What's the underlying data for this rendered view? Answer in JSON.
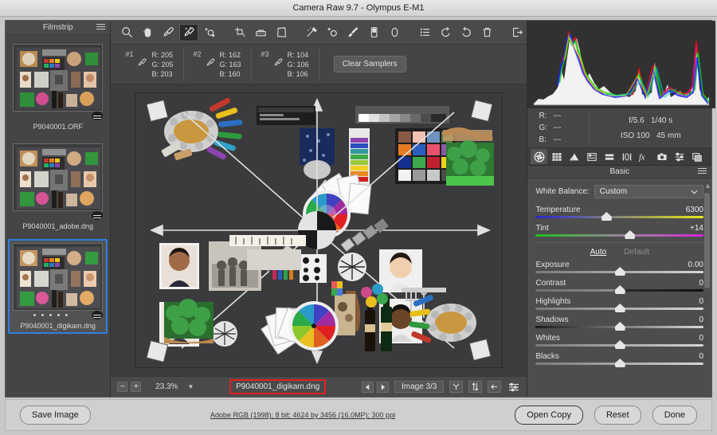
{
  "window": {
    "title": "Camera Raw 9.7  -  Olympus E-M1"
  },
  "filmstrip": {
    "header": "Filmstrip",
    "menu_icon": "hamburger-icon",
    "items": [
      {
        "label": "P9040001.ORF",
        "selected": false,
        "has_dots": false
      },
      {
        "label": "P9040001_adobe.dng",
        "selected": false,
        "has_dots": false
      },
      {
        "label": "P9040001_digikam.dng",
        "selected": true,
        "has_dots": true
      }
    ]
  },
  "toolbar": {
    "tools": [
      {
        "name": "zoom-tool",
        "icon": "magnifier-icon",
        "active": false
      },
      {
        "name": "hand-tool",
        "icon": "hand-icon",
        "active": false
      },
      {
        "name": "white-balance-tool",
        "icon": "eyedropper-icon",
        "active": false
      },
      {
        "name": "color-sampler-tool",
        "icon": "color-sampler-icon",
        "active": true
      },
      {
        "name": "targeted-adjustment-tool",
        "icon": "target-adjust-icon",
        "active": false
      },
      {
        "name": "crop-tool",
        "icon": "crop-icon",
        "active": false
      },
      {
        "name": "straighten-tool",
        "icon": "straighten-icon",
        "active": false
      },
      {
        "name": "transform-tool",
        "icon": "transform-icon",
        "active": false
      },
      {
        "name": "spot-removal-tool",
        "icon": "spot-removal-icon",
        "active": false
      },
      {
        "name": "red-eye-tool",
        "icon": "red-eye-icon",
        "active": false
      },
      {
        "name": "adjustment-brush-tool",
        "icon": "brush-icon",
        "active": false
      },
      {
        "name": "graduated-filter-tool",
        "icon": "graduated-filter-icon",
        "active": false
      },
      {
        "name": "radial-filter-tool",
        "icon": "radial-filter-icon",
        "active": false
      },
      {
        "name": "preferences-tool",
        "icon": "preferences-icon",
        "active": false
      },
      {
        "name": "rotate-left-tool",
        "icon": "rotate-ccw-icon",
        "active": false
      },
      {
        "name": "rotate-right-tool",
        "icon": "rotate-cw-icon",
        "active": false
      },
      {
        "name": "delete-tool",
        "icon": "trash-icon",
        "active": false
      },
      {
        "name": "open-preferences-tool",
        "icon": "export-icon",
        "active": false
      }
    ]
  },
  "samplers": {
    "clear_label": "Clear Samplers",
    "items": [
      {
        "id": "#1",
        "r": "R: 205",
        "g": "G: 205",
        "b": "B: 203"
      },
      {
        "id": "#2",
        "r": "R: 162",
        "g": "G: 163",
        "b": "B: 160"
      },
      {
        "id": "#3",
        "r": "R: 104",
        "g": "G: 106",
        "b": "B: 106"
      }
    ]
  },
  "bottombar": {
    "zoom_out": "−",
    "zoom_in": "+",
    "zoom_level": "23.3%",
    "zoom_dropdown_icon": "chevron-down-icon",
    "filename": "P9040001_digikam.dng",
    "filename_highlight_color": "#e02020",
    "prev_icon": "arrow-left-icon",
    "next_icon": "arrow-right-icon",
    "image_count": "Image 3/3",
    "minitools": [
      {
        "name": "synchronize-button",
        "icon": "Y-icon"
      },
      {
        "name": "swap-button",
        "icon": "two-arrows-icon"
      },
      {
        "name": "back-button",
        "icon": "arrow-left-box-icon"
      },
      {
        "name": "settings-button",
        "icon": "sliders-icon"
      }
    ]
  },
  "histogram": {
    "shadow_clip_icon": "triangle-shadow-clip-icon",
    "shadow_clip_color": "#2222dd",
    "highlight_clip_icon": "triangle-highlight-clip-icon",
    "highlight_clip_color": "#dd1111"
  },
  "info": {
    "r_label": "R:",
    "r_value": "---",
    "g_label": "G:",
    "g_value": "---",
    "b_label": "B:",
    "b_value": "---",
    "aperture": "f/5.6",
    "shutter": "1/40 s",
    "iso": "ISO 100",
    "focal": "45 mm"
  },
  "panel_tabs": [
    {
      "name": "tab-basic",
      "icon": "aperture-icon",
      "active": true
    },
    {
      "name": "tab-tone-curve",
      "icon": "tone-curve-icon",
      "active": false
    },
    {
      "name": "tab-detail",
      "icon": "detail-triangle-icon",
      "active": false
    },
    {
      "name": "tab-hsl-grayscale",
      "icon": "hsl-icon",
      "active": false
    },
    {
      "name": "tab-split-toning",
      "icon": "split-toning-icon",
      "active": false
    },
    {
      "name": "tab-lens-corrections",
      "icon": "lens-correction-icon",
      "active": false
    },
    {
      "name": "tab-effects",
      "icon": "fx-icon",
      "active": false
    },
    {
      "name": "tab-camera-calibration",
      "icon": "camera-icon",
      "active": false
    },
    {
      "name": "tab-presets",
      "icon": "presets-sliders-icon",
      "active": false
    },
    {
      "name": "tab-snapshots",
      "icon": "snapshots-icon",
      "active": false
    }
  ],
  "basic_panel": {
    "title": "Basic",
    "menu_icon": "hamburger-icon",
    "white_balance_label": "White Balance:",
    "white_balance_value": "Custom",
    "white_balance_caret": "chevron-down-icon",
    "auto_label": "Auto",
    "default_label": "Default",
    "sliders": [
      {
        "label": "Temperature",
        "value": "6300",
        "pos": 42,
        "track": "temp"
      },
      {
        "label": "Tint",
        "value": "+14",
        "pos": 56,
        "track": "tint"
      },
      {
        "label": "Exposure",
        "value": "0.00",
        "pos": 50,
        "track": "plain"
      },
      {
        "label": "Contrast",
        "value": "0",
        "pos": 50,
        "track": "contrast"
      },
      {
        "label": "Highlights",
        "value": "0",
        "pos": 50,
        "track": "plain"
      },
      {
        "label": "Shadows",
        "value": "0",
        "pos": 50,
        "track": "shadows"
      },
      {
        "label": "Whites",
        "value": "0",
        "pos": 50,
        "track": "plain"
      },
      {
        "label": "Blacks",
        "value": "0",
        "pos": 50,
        "track": "plain"
      }
    ],
    "scroll_up_icon": "chevron-up-icon",
    "scroll_down_icon": "chevron-down-icon"
  },
  "footer": {
    "save_label": "Save Image",
    "info": "Adobe RGB (1998); 8 bit; 4624 by 3456 (16.0MP); 300 ppi",
    "open_copy_label": "Open Copy",
    "reset_label": "Reset",
    "done_label": "Done"
  }
}
